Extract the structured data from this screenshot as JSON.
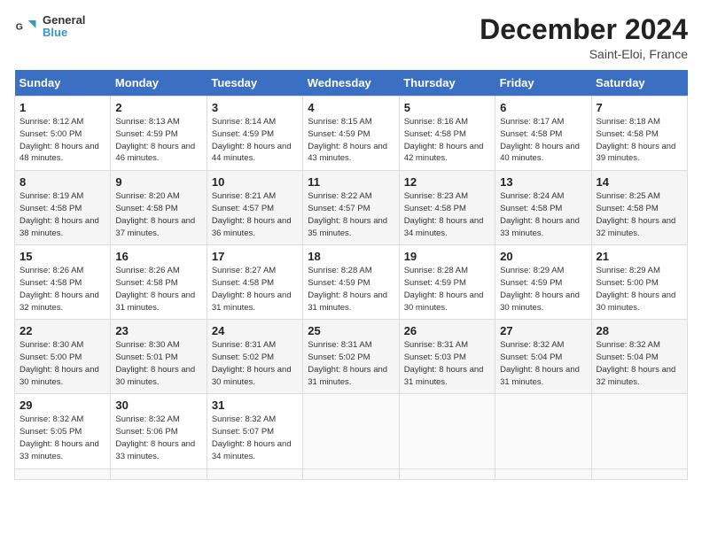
{
  "header": {
    "logo": {
      "general": "General",
      "blue": "Blue"
    },
    "title": "December 2024",
    "location": "Saint-Eloi, France"
  },
  "calendar": {
    "days_of_week": [
      "Sunday",
      "Monday",
      "Tuesday",
      "Wednesday",
      "Thursday",
      "Friday",
      "Saturday"
    ],
    "weeks": [
      [
        null,
        null,
        null,
        null,
        null,
        null,
        null
      ]
    ],
    "cells": [
      {
        "day": 1,
        "dow": 0,
        "sunrise": "8:12 AM",
        "sunset": "5:00 PM",
        "daylight": "8 hours and 48 minutes."
      },
      {
        "day": 2,
        "dow": 1,
        "sunrise": "8:13 AM",
        "sunset": "4:59 PM",
        "daylight": "8 hours and 46 minutes."
      },
      {
        "day": 3,
        "dow": 2,
        "sunrise": "8:14 AM",
        "sunset": "4:59 PM",
        "daylight": "8 hours and 44 minutes."
      },
      {
        "day": 4,
        "dow": 3,
        "sunrise": "8:15 AM",
        "sunset": "4:59 PM",
        "daylight": "8 hours and 43 minutes."
      },
      {
        "day": 5,
        "dow": 4,
        "sunrise": "8:16 AM",
        "sunset": "4:58 PM",
        "daylight": "8 hours and 42 minutes."
      },
      {
        "day": 6,
        "dow": 5,
        "sunrise": "8:17 AM",
        "sunset": "4:58 PM",
        "daylight": "8 hours and 40 minutes."
      },
      {
        "day": 7,
        "dow": 6,
        "sunrise": "8:18 AM",
        "sunset": "4:58 PM",
        "daylight": "8 hours and 39 minutes."
      },
      {
        "day": 8,
        "dow": 0,
        "sunrise": "8:19 AM",
        "sunset": "4:58 PM",
        "daylight": "8 hours and 38 minutes."
      },
      {
        "day": 9,
        "dow": 1,
        "sunrise": "8:20 AM",
        "sunset": "4:58 PM",
        "daylight": "8 hours and 37 minutes."
      },
      {
        "day": 10,
        "dow": 2,
        "sunrise": "8:21 AM",
        "sunset": "4:57 PM",
        "daylight": "8 hours and 36 minutes."
      },
      {
        "day": 11,
        "dow": 3,
        "sunrise": "8:22 AM",
        "sunset": "4:57 PM",
        "daylight": "8 hours and 35 minutes."
      },
      {
        "day": 12,
        "dow": 4,
        "sunrise": "8:23 AM",
        "sunset": "4:58 PM",
        "daylight": "8 hours and 34 minutes."
      },
      {
        "day": 13,
        "dow": 5,
        "sunrise": "8:24 AM",
        "sunset": "4:58 PM",
        "daylight": "8 hours and 33 minutes."
      },
      {
        "day": 14,
        "dow": 6,
        "sunrise": "8:25 AM",
        "sunset": "4:58 PM",
        "daylight": "8 hours and 32 minutes."
      },
      {
        "day": 15,
        "dow": 0,
        "sunrise": "8:26 AM",
        "sunset": "4:58 PM",
        "daylight": "8 hours and 32 minutes."
      },
      {
        "day": 16,
        "dow": 1,
        "sunrise": "8:26 AM",
        "sunset": "4:58 PM",
        "daylight": "8 hours and 31 minutes."
      },
      {
        "day": 17,
        "dow": 2,
        "sunrise": "8:27 AM",
        "sunset": "4:58 PM",
        "daylight": "8 hours and 31 minutes."
      },
      {
        "day": 18,
        "dow": 3,
        "sunrise": "8:28 AM",
        "sunset": "4:59 PM",
        "daylight": "8 hours and 31 minutes."
      },
      {
        "day": 19,
        "dow": 4,
        "sunrise": "8:28 AM",
        "sunset": "4:59 PM",
        "daylight": "8 hours and 30 minutes."
      },
      {
        "day": 20,
        "dow": 5,
        "sunrise": "8:29 AM",
        "sunset": "4:59 PM",
        "daylight": "8 hours and 30 minutes."
      },
      {
        "day": 21,
        "dow": 6,
        "sunrise": "8:29 AM",
        "sunset": "5:00 PM",
        "daylight": "8 hours and 30 minutes."
      },
      {
        "day": 22,
        "dow": 0,
        "sunrise": "8:30 AM",
        "sunset": "5:00 PM",
        "daylight": "8 hours and 30 minutes."
      },
      {
        "day": 23,
        "dow": 1,
        "sunrise": "8:30 AM",
        "sunset": "5:01 PM",
        "daylight": "8 hours and 30 minutes."
      },
      {
        "day": 24,
        "dow": 2,
        "sunrise": "8:31 AM",
        "sunset": "5:02 PM",
        "daylight": "8 hours and 30 minutes."
      },
      {
        "day": 25,
        "dow": 3,
        "sunrise": "8:31 AM",
        "sunset": "5:02 PM",
        "daylight": "8 hours and 31 minutes."
      },
      {
        "day": 26,
        "dow": 4,
        "sunrise": "8:31 AM",
        "sunset": "5:03 PM",
        "daylight": "8 hours and 31 minutes."
      },
      {
        "day": 27,
        "dow": 5,
        "sunrise": "8:32 AM",
        "sunset": "5:04 PM",
        "daylight": "8 hours and 31 minutes."
      },
      {
        "day": 28,
        "dow": 6,
        "sunrise": "8:32 AM",
        "sunset": "5:04 PM",
        "daylight": "8 hours and 32 minutes."
      },
      {
        "day": 29,
        "dow": 0,
        "sunrise": "8:32 AM",
        "sunset": "5:05 PM",
        "daylight": "8 hours and 33 minutes."
      },
      {
        "day": 30,
        "dow": 1,
        "sunrise": "8:32 AM",
        "sunset": "5:06 PM",
        "daylight": "8 hours and 33 minutes."
      },
      {
        "day": 31,
        "dow": 2,
        "sunrise": "8:32 AM",
        "sunset": "5:07 PM",
        "daylight": "8 hours and 34 minutes."
      }
    ],
    "labels": {
      "sunrise": "Sunrise:",
      "sunset": "Sunset:",
      "daylight": "Daylight:"
    }
  }
}
